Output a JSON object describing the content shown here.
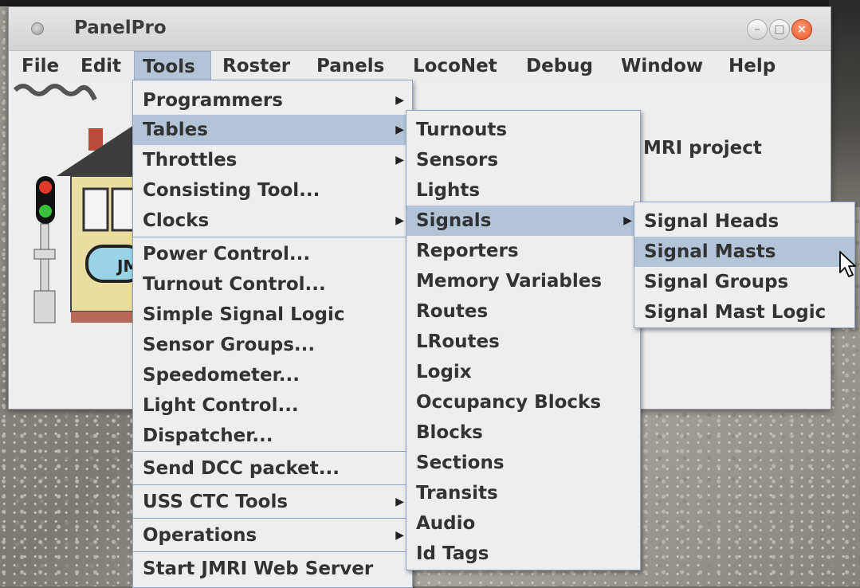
{
  "window": {
    "title": "PanelPro",
    "controls": [
      "–",
      "□",
      "×"
    ]
  },
  "menubar": [
    "File",
    "Edit",
    "Tools",
    "Roster",
    "Panels",
    "LocoNet",
    "Debug",
    "Window",
    "Help"
  ],
  "background_text": "MRI project",
  "logo_text": "JM",
  "tools_menu": [
    {
      "label": "Programmers",
      "submenu": true
    },
    {
      "label": "Tables",
      "submenu": true,
      "highlighted": true
    },
    {
      "label": "Throttles",
      "submenu": true
    },
    {
      "label": "Consisting Tool...",
      "submenu": false
    },
    {
      "label": "Clocks",
      "submenu": true
    },
    {
      "label": "Power Control...",
      "submenu": false
    },
    {
      "label": "Turnout Control...",
      "submenu": false
    },
    {
      "label": "Simple Signal Logic",
      "submenu": false
    },
    {
      "label": "Sensor Groups...",
      "submenu": false
    },
    {
      "label": "Speedometer...",
      "submenu": false
    },
    {
      "label": "Light Control...",
      "submenu": false
    },
    {
      "label": "Dispatcher...",
      "submenu": false
    },
    {
      "label": "Send DCC packet...",
      "submenu": false
    },
    {
      "label": "USS CTC Tools",
      "submenu": true
    },
    {
      "label": "Operations",
      "submenu": true
    },
    {
      "label": "Start JMRI Web Server",
      "submenu": false
    }
  ],
  "tables_menu": [
    {
      "label": "Turnouts"
    },
    {
      "label": "Sensors"
    },
    {
      "label": "Lights"
    },
    {
      "label": "Signals",
      "submenu": true,
      "highlighted": true
    },
    {
      "label": "Reporters"
    },
    {
      "label": "Memory Variables"
    },
    {
      "label": "Routes"
    },
    {
      "label": "LRoutes"
    },
    {
      "label": "Logix"
    },
    {
      "label": "Occupancy Blocks"
    },
    {
      "label": "Blocks"
    },
    {
      "label": "Sections"
    },
    {
      "label": "Transits"
    },
    {
      "label": "Audio"
    },
    {
      "label": "Id Tags"
    }
  ],
  "signals_menu": [
    {
      "label": "Signal Heads"
    },
    {
      "label": "Signal Masts",
      "highlighted": true
    },
    {
      "label": "Signal Groups"
    },
    {
      "label": "Signal Mast Logic"
    }
  ],
  "colors": {
    "highlight": "#b3c3d8",
    "menu_bg": "#eeeeee",
    "border": "#8da3bf"
  },
  "icons": [
    "arrow-right-icon",
    "mouse-pointer-icon",
    "signal-light-icon",
    "house-logo-icon"
  ]
}
